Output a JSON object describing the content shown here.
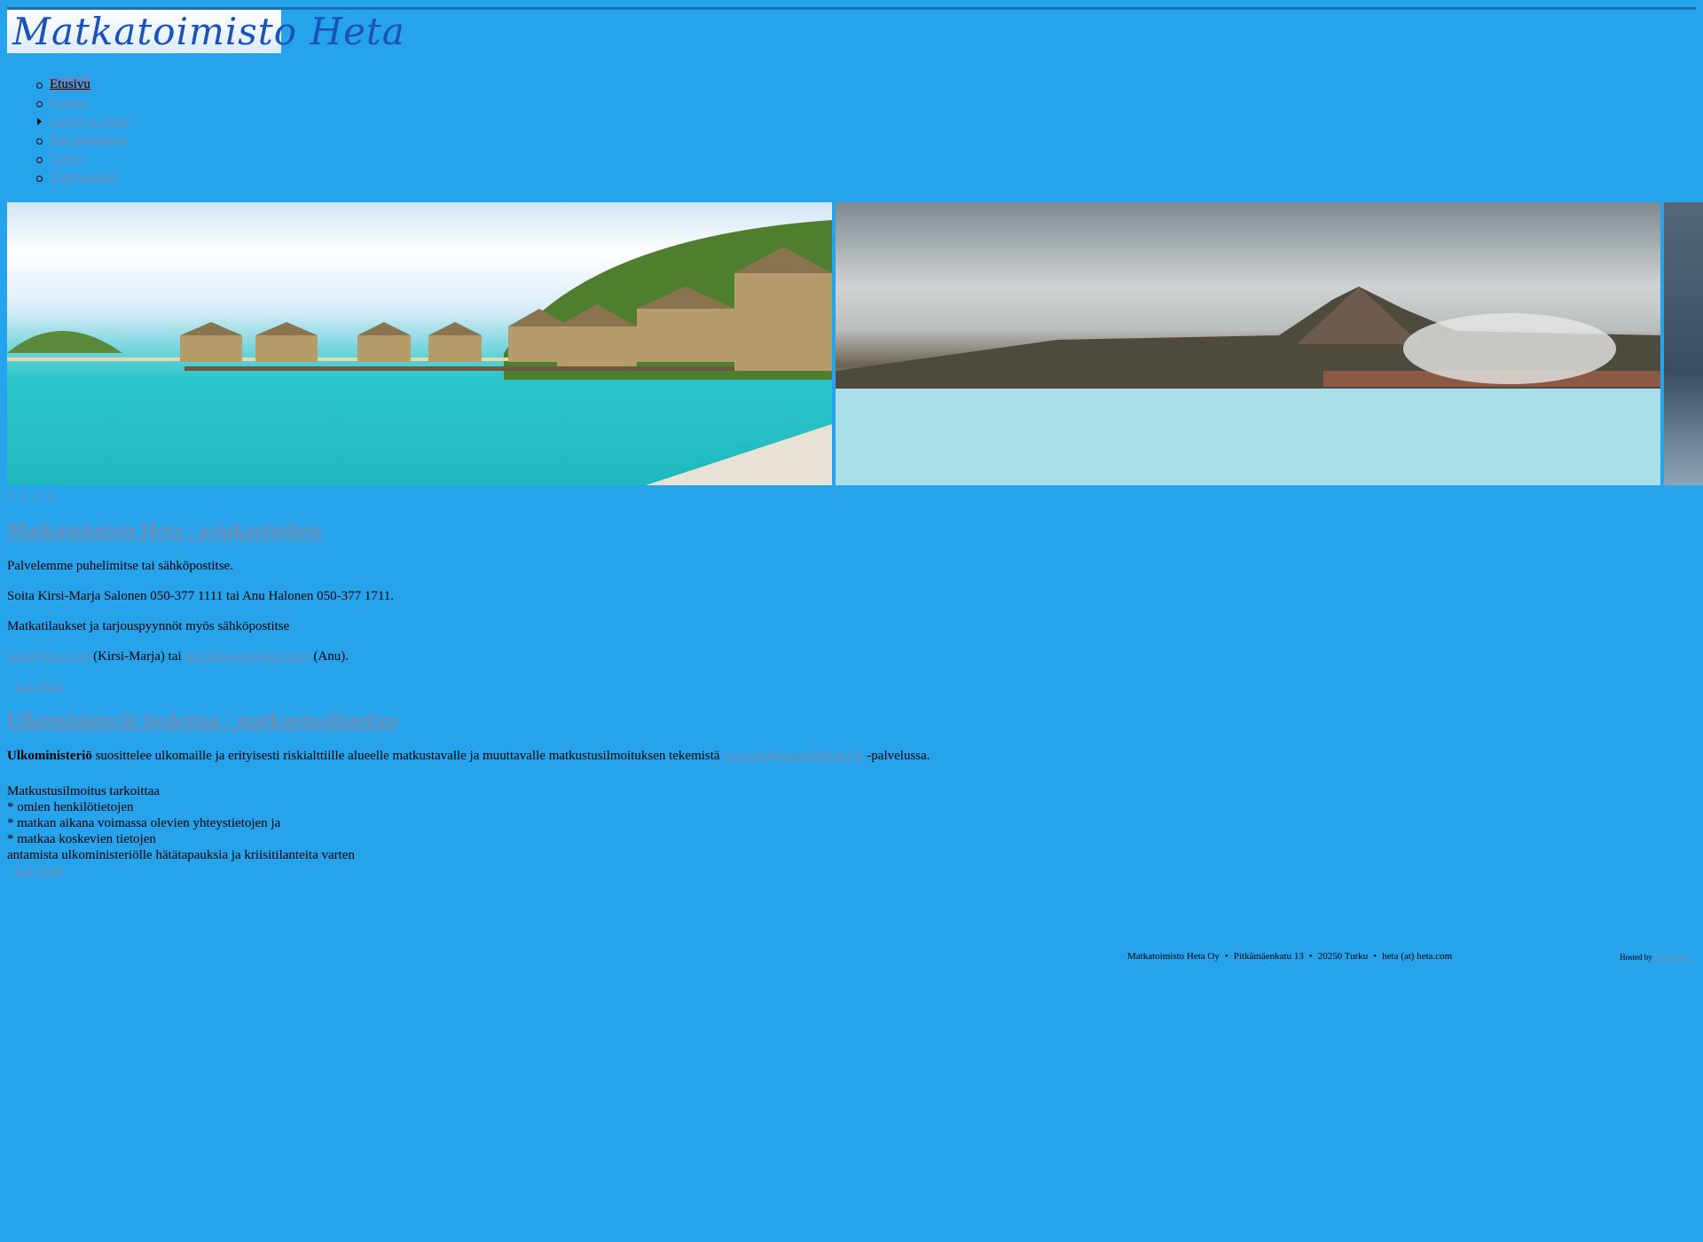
{
  "logo": {
    "text": "Matkatoimisto Heta"
  },
  "nav": {
    "items": [
      {
        "label": "Etusivu"
      },
      {
        "label": "Uutiset"
      },
      {
        "label": "Linkit ja vinkit"
      },
      {
        "label": "Palvelumaksut"
      },
      {
        "label": "Yritys"
      },
      {
        "label": "Yhteystiedot"
      }
    ]
  },
  "slider": {
    "pages": [
      "1",
      "2",
      "3",
      "4"
    ]
  },
  "articles": [
    {
      "title": "Matkatoimisto Heta - asiakastiedote",
      "p1": "Palvelemme puhelimitse tai sähköpostitse.",
      "p2": "Soita Kirsi-Marja Salonen 050-377 1111 tai Anu Halonen 050-377 1711.",
      "p3": "Matkatilaukset ja tarjouspyynnöt myös sähköpostitse",
      "email1": "heta@heta.com",
      "email1_suffix": " (Kirsi-Marja) tai ",
      "email2": "anu.halonen@heta.com",
      "email2_suffix": " (Anu).",
      "read_more": "Lue lisää"
    },
    {
      "title": "Ulkoministeriö tiedottaa - matkustusilmoitus",
      "bold": "Ulkoministeriö",
      "text": " suosittelee ulkomaille ja erityisesti riskialttiille alueelle matkustavalle ja muuttavalle matkustusilmoituksen tekemistä ",
      "link": "www.matkustusilmoitus.fi",
      "text_end": " -palvelussa.",
      "lines": [
        "Matkustusilmoitus tarkoittaa",
        "* omien henkilötietojen",
        "* matkan aikana voimassa olevien yhteystietojen ja",
        "* matkaa koskevien tietojen",
        "antamista ulkoministeriölle hätätapauksia ja kriisitilanteita varten"
      ],
      "read_more": "Lue lisää"
    }
  ],
  "footer": {
    "company": "Matkatoimisto Heta Oy",
    "street": "Pitkämäenkatu 13",
    "city": "20250 Turku",
    "email": "heta (at) heta.com",
    "sep": "•",
    "hosted_by": "Hosted by",
    "host": "Loota.com"
  }
}
